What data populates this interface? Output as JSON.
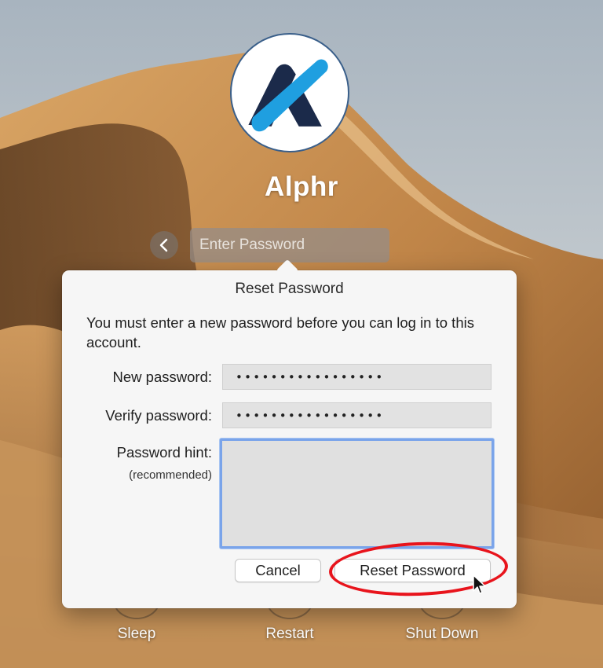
{
  "colors": {
    "sky": "#b9c3cb",
    "sand": "#c18a4e",
    "accent_blue": "#1f9fe0",
    "logo_navy": "#1b2a4a",
    "focus_ring": "#7aa4ea",
    "highlight_red": "#e8141c"
  },
  "user": {
    "avatar_icon": "alphr-logo-icon",
    "name": "Alphr"
  },
  "login": {
    "back_icon": "chevron-left-icon",
    "password_placeholder": "Enter Password",
    "password_value": ""
  },
  "dialog": {
    "title": "Reset Password",
    "message": "You must enter a new password before you can log in to this account.",
    "new_password_label": "New password:",
    "new_password_value": "•••••••••••••••••",
    "verify_password_label": "Verify password:",
    "verify_password_value": "•••••••••••••••••",
    "hint_label": "Password hint:",
    "hint_sublabel": "(recommended)",
    "hint_value": "",
    "cancel_label": "Cancel",
    "reset_label": "Reset Password"
  },
  "power": {
    "sleep_label": "Sleep",
    "restart_label": "Restart",
    "shutdown_label": "Shut Down"
  }
}
